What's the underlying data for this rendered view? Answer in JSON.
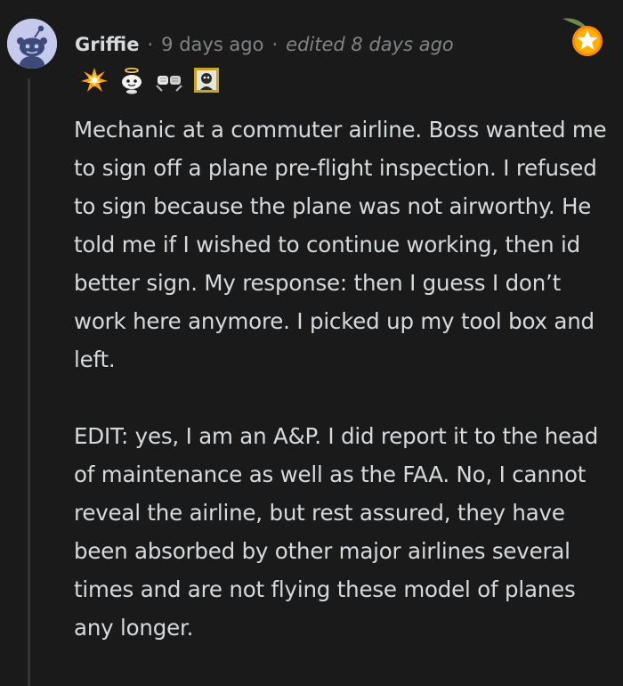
{
  "comment": {
    "author": "Griffie",
    "separator_1": "·",
    "time": "9 days ago",
    "separator_2": "·",
    "edited": "edited 8 days ago",
    "avatar_icon": "snoo-avatar-icon",
    "badge_icon": "star-badge-icon",
    "awards": [
      {
        "icon": "burst-award-icon"
      },
      {
        "icon": "snoo-halo-award-icon"
      },
      {
        "icon": "fist-bump-award-icon"
      },
      {
        "icon": "framed-portrait-award-icon"
      }
    ],
    "paragraphs": [
      "Mechanic at a commuter airline. Boss wanted me to sign off a plane pre-flight inspection. I refused to sign because the plane was not airworthy. He told me if I wished to continue working, then id better sign. My response: then I guess I don’t work here anymore. I picked up my tool box and left.",
      "EDIT: yes, I am an A&P. I did report it to the head of maintenance as well as the FAA. No, I cannot reveal the airline, but rest assured, they have been absorbed by other major airlines several times and are not flying these model of planes any longer."
    ]
  },
  "colors": {
    "background": "#1a1a1b",
    "text": "#d7dadc",
    "muted": "#818384",
    "avatar_bg": "#c5c9ec",
    "badge_orange": "#ff8717"
  }
}
